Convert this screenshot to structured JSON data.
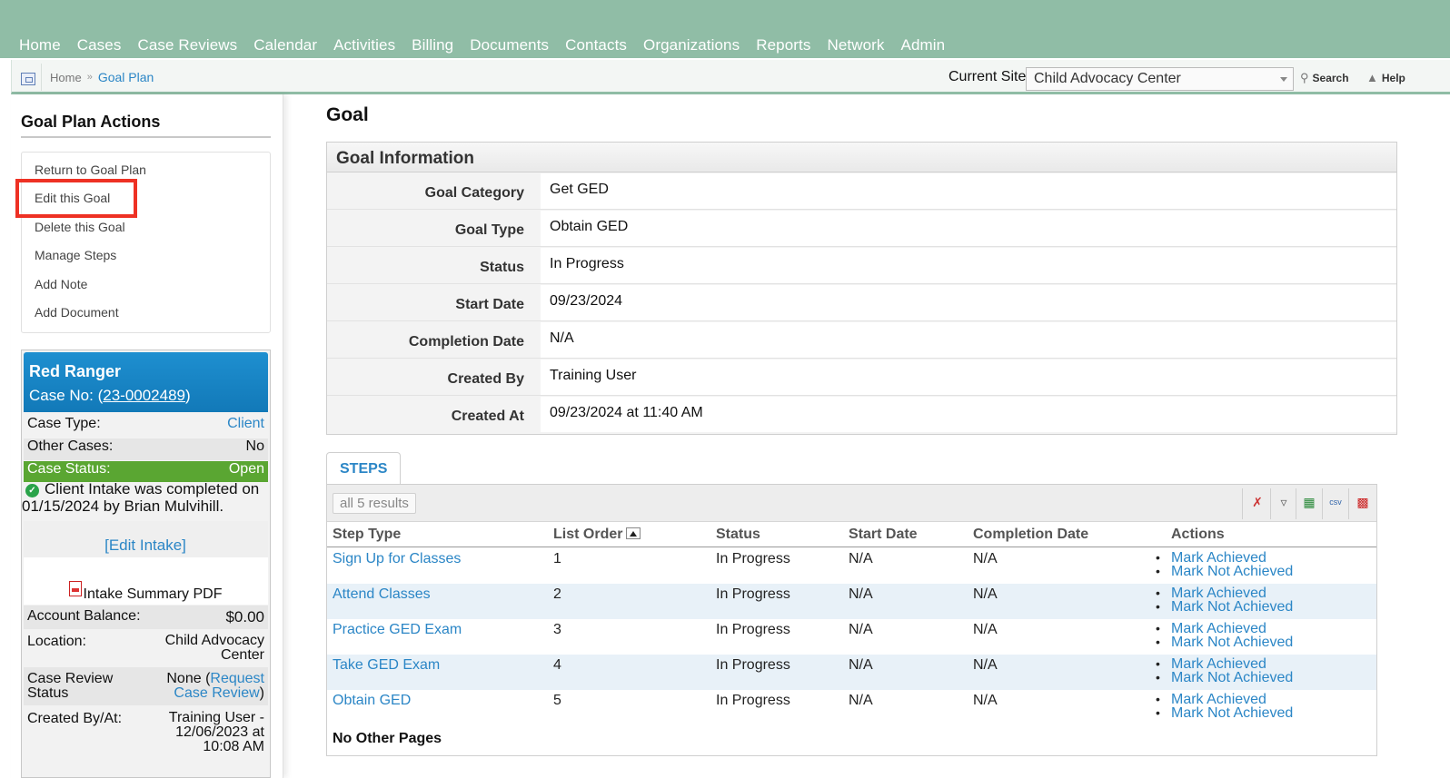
{
  "nav": [
    "Home",
    "Cases",
    "Case Reviews",
    "Calendar",
    "Activities",
    "Billing",
    "Documents",
    "Contacts",
    "Organizations",
    "Reports",
    "Network",
    "Admin"
  ],
  "breadcrumb": {
    "home": "Home",
    "separator": "»",
    "current": "Goal Plan"
  },
  "site": {
    "label": "Current Site",
    "value": "Child Advocacy Center",
    "search": "Search",
    "help": "Help"
  },
  "sidebar": {
    "title": "Goal Plan Actions",
    "actions": [
      "Return to Goal Plan",
      "Edit this Goal",
      "Delete this Goal",
      "Manage Steps",
      "Add Note",
      "Add Document"
    ]
  },
  "case_card": {
    "name": "Red Ranger",
    "case_no_label": "Case No: (",
    "case_no": "23-0002489",
    "case_no_close": ")",
    "case_type_label": "Case Type:",
    "case_type": "Client",
    "other_cases_label": "Other Cases:",
    "other_cases": "No",
    "case_status_label": "Case Status:",
    "case_status": "Open",
    "intake_text": "Client Intake was completed on 01/15/2024 by Brian Mulvihill.",
    "edit_intake": "[Edit Intake]",
    "intake_pdf": "Intake Summary PDF",
    "account_balance_label": "Account Balance:",
    "account_balance": "$0.00",
    "location_label": "Location:",
    "location_line1": "Child Advocacy",
    "location_line2": "Center",
    "review_label_1": "Case Review",
    "review_label_2": "Status",
    "review_none": "None (",
    "review_link_1": "Request",
    "review_link_2": "Case Review",
    "review_close": ")",
    "created_label": "Created By/At:",
    "created_line1": "Training User -",
    "created_line2": "12/06/2023 at",
    "created_line3": "10:08 AM"
  },
  "main": {
    "title": "Goal",
    "info_title": "Goal Information",
    "fields": [
      {
        "label": "Goal Category",
        "value": "Get GED"
      },
      {
        "label": "Goal Type",
        "value": "Obtain GED"
      },
      {
        "label": "Status",
        "value": "In Progress"
      },
      {
        "label": "Start Date",
        "value": "09/23/2024"
      },
      {
        "label": "Completion Date",
        "value": "N/A"
      },
      {
        "label": "Created By",
        "value": "Training User"
      },
      {
        "label": "Created At",
        "value": "09/23/2024 at 11:40 AM"
      }
    ]
  },
  "steps": {
    "tab": "STEPS",
    "results": "all 5 results",
    "toolbar_icons": [
      "clear-filter-icon",
      "filter-icon",
      "excel-export-icon",
      "csv-export-icon",
      "pdf-export-icon"
    ],
    "columns": [
      "Step Type",
      "List Order",
      "Status",
      "Start Date",
      "Completion Date",
      "Actions"
    ],
    "rows": [
      {
        "type": "Sign Up for Classes",
        "order": "1",
        "status": "In Progress",
        "start": "N/A",
        "completion": "N/A"
      },
      {
        "type": "Attend Classes",
        "order": "2",
        "status": "In Progress",
        "start": "N/A",
        "completion": "N/A"
      },
      {
        "type": "Practice GED Exam",
        "order": "3",
        "status": "In Progress",
        "start": "N/A",
        "completion": "N/A"
      },
      {
        "type": "Take GED Exam",
        "order": "4",
        "status": "In Progress",
        "start": "N/A",
        "completion": "N/A"
      },
      {
        "type": "Obtain GED",
        "order": "5",
        "status": "In Progress",
        "start": "N/A",
        "completion": "N/A"
      }
    ],
    "action_achieved": "Mark Achieved",
    "action_not_achieved": "Mark Not Achieved",
    "footer": "No Other Pages"
  },
  "colors": {
    "topbar": "#90bda6",
    "link": "#2b86c6",
    "card_header": "#1a86c6",
    "status_green": "#5aa632",
    "highlight_red": "#ee3124"
  }
}
